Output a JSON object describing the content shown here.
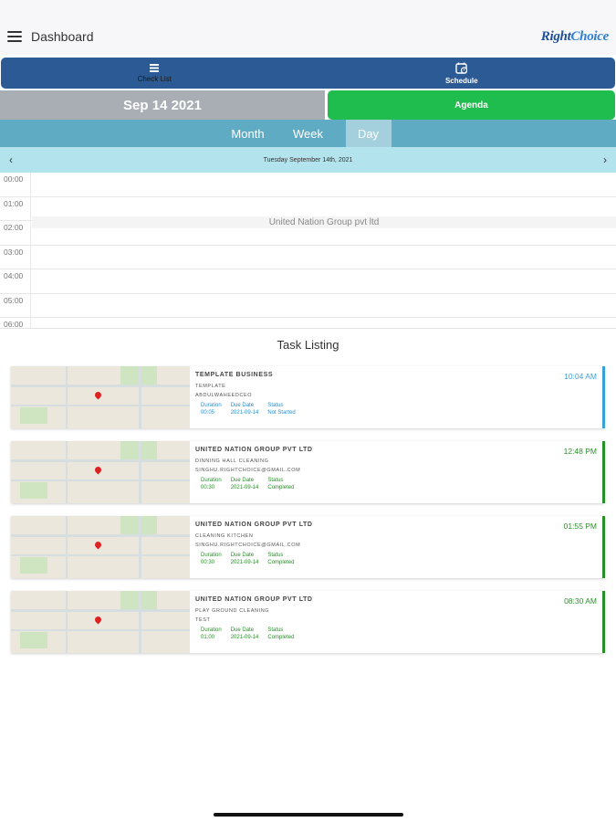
{
  "header": {
    "title": "Dashboard",
    "logo": {
      "text_a": "Right",
      "text_b": "Choice"
    }
  },
  "tabs": {
    "checklist_label": "Check List",
    "schedule_label": "Schedule",
    "checklist_icon": "list-icon",
    "schedule_icon": "calendar-clock-icon"
  },
  "datebar": {
    "date": "Sep 14 2021",
    "agenda_label": "Agenda"
  },
  "view_tabs": [
    "Month",
    "Week",
    "Day"
  ],
  "active_view": "Day",
  "day_nav": {
    "label": "Tuesday September 14th, 2021",
    "prev": "‹",
    "next": "›"
  },
  "hours": [
    "00:00",
    "01:00",
    "02:00",
    "03:00",
    "04:00",
    "05:00",
    "06:00"
  ],
  "event": {
    "title": "United Nation Group pvt ltd"
  },
  "task_listing_title": "Task Listing",
  "task_labels": {
    "duration": "Duration",
    "due_date": "Due Date",
    "status": "Status"
  },
  "tasks": [
    {
      "client": "TEMPLATE BUSINESS",
      "task": "TEMPLATE",
      "contact": "ABDULWAHEEDCEO",
      "time": "10:04 AM",
      "duration": "00:05",
      "due_date": "2021-09-14",
      "status": "Not Started"
    },
    {
      "client": "UNITED NATION GROUP PVT LTD",
      "task": "DINNING HALL CLEANING",
      "contact": "SINGHU.RIGHTCHOICE@GMAIL.COM",
      "time": "12:48 PM",
      "duration": "00:30",
      "due_date": "2021-09-14",
      "status": "Completed"
    },
    {
      "client": "UNITED NATION GROUP PVT LTD",
      "task": "CLEANING KITCHEN",
      "contact": "SINGHU.RIGHTCHOICE@GMAIL.COM",
      "time": "01:55 PM",
      "duration": "00:30",
      "due_date": "2021-09-14",
      "status": "Completed"
    },
    {
      "client": "UNITED NATION GROUP PVT LTD",
      "task": "PLAY GROUND CLEANING",
      "contact": "TEST",
      "time": "08:30 AM",
      "duration": "01:00",
      "due_date": "2021-09-14",
      "status": "Completed"
    }
  ]
}
